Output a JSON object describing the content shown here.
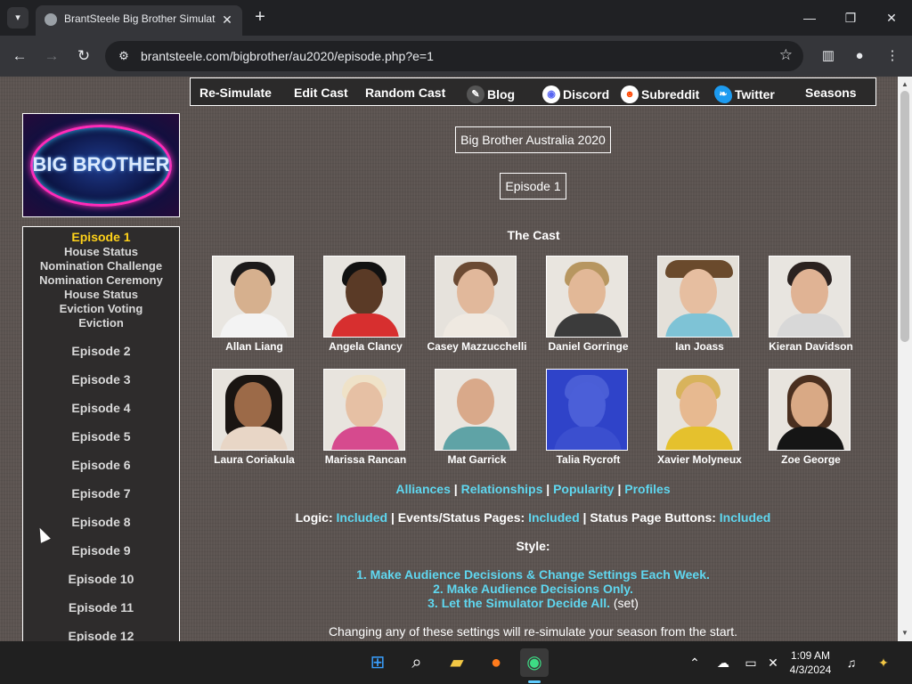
{
  "browser": {
    "tab_title": "BrantSteele Big Brother Simulat",
    "url": "brantsteele.com/bigbrother/au2020/episode.php?e=1",
    "tab_close": "✕",
    "new_tab": "+",
    "window": {
      "minimize": "—",
      "restore": "❐",
      "close": "✕"
    }
  },
  "topnav": {
    "resimulate": "Re-Simulate",
    "edit_cast": "Edit Cast",
    "random_cast": "Random Cast",
    "blog": "Blog",
    "discord": "Discord",
    "subreddit": "Subreddit",
    "twitter": "Twitter",
    "seasons": "Seasons"
  },
  "logo": {
    "text": "BIG BROTHER"
  },
  "sidebar": {
    "current_episode": "Episode 1",
    "sub_items": [
      "House Status",
      "Nomination Challenge",
      "Nomination Ceremony",
      "House Status",
      "Eviction Voting",
      "Eviction"
    ],
    "episodes": [
      "Episode 2",
      "Episode 3",
      "Episode 4",
      "Episode 5",
      "Episode 6",
      "Episode 7",
      "Episode 8",
      "Episode 9",
      "Episode 10",
      "Episode 11",
      "Episode 12"
    ]
  },
  "main": {
    "season_title": "Big Brother Australia 2020",
    "episode_title": "Episode 1",
    "cast_heading": "The Cast",
    "cast": [
      {
        "name": "Allan Liang"
      },
      {
        "name": "Angela Clancy"
      },
      {
        "name": "Casey Mazzucchelli"
      },
      {
        "name": "Daniel Gorringe"
      },
      {
        "name": "Ian Joass"
      },
      {
        "name": "Kieran Davidson"
      },
      {
        "name": "Laura Coriakula"
      },
      {
        "name": "Marissa Rancan"
      },
      {
        "name": "Mat Garrick"
      },
      {
        "name": "Talia Rycroft"
      },
      {
        "name": "Xavier Molyneux"
      },
      {
        "name": "Zoe George"
      }
    ],
    "stat_links": {
      "alliances": "Alliances",
      "relationships": "Relationships",
      "popularity": "Popularity",
      "profiles": "Profiles",
      "sep": "|"
    },
    "settings": {
      "logic_label": "Logic:",
      "logic_value": "Included",
      "events_label": "Events/Status Pages:",
      "events_value": "Included",
      "buttons_label": "Status Page Buttons:",
      "buttons_value": "Included",
      "sep": "|"
    },
    "style": {
      "label": "Style:",
      "option1": "1. Make Audience Decisions & Change Settings Each Week.",
      "option2": "2. Make Audience Decisions Only.",
      "option3": "3. Let the Simulator Decide All.",
      "option3_note": "(set)"
    },
    "warning": "Changing any of these settings will re-simulate your season from the start."
  },
  "taskbar": {
    "time": "1:09 AM",
    "date": "4/3/2024"
  }
}
